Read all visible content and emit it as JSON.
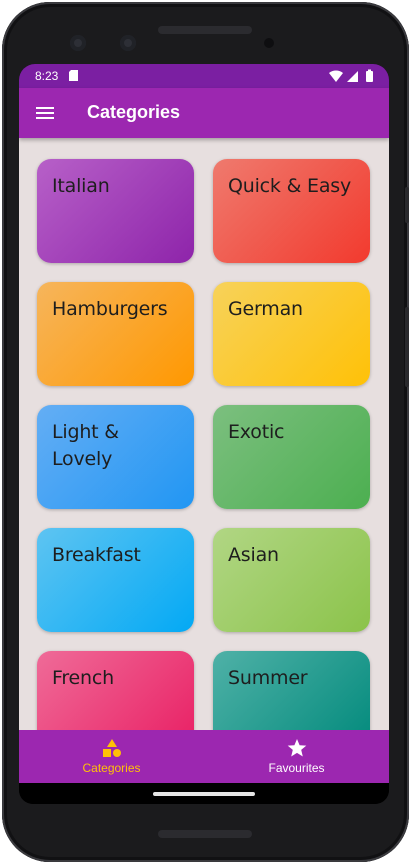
{
  "status_bar": {
    "time": "8:23",
    "background": "#7b1fa2"
  },
  "app_bar": {
    "title": "Categories",
    "menu_icon": "hamburger-menu-icon",
    "background": "#9c27b0"
  },
  "categories": [
    {
      "label": "Italian",
      "color_from": "#b760c8",
      "color_to": "#8e24aa"
    },
    {
      "label": "Quick & Easy",
      "color_from": "#ef7a6e",
      "color_to": "#f23a2e"
    },
    {
      "label": "Hamburgers",
      "color_from": "#f6b55c",
      "color_to": "#ff9800"
    },
    {
      "label": "German",
      "color_from": "#f7d25a",
      "color_to": "#ffc107"
    },
    {
      "label": "Light & Lovely",
      "color_from": "#64aef4",
      "color_to": "#2196f3"
    },
    {
      "label": "Exotic",
      "color_from": "#7cbf7f",
      "color_to": "#4caf50"
    },
    {
      "label": "Breakfast",
      "color_from": "#5ec4f2",
      "color_to": "#03a9f4"
    },
    {
      "label": "Asian",
      "color_from": "#b1d684",
      "color_to": "#8bc34a"
    },
    {
      "label": "French",
      "color_from": "#ef6b98",
      "color_to": "#e91e63"
    },
    {
      "label": "Summer",
      "color_from": "#4fb1a7",
      "color_to": "#00897b"
    }
  ],
  "bottom_nav": {
    "items": [
      {
        "label": "Categories",
        "icon": "category-shapes-icon",
        "active": true
      },
      {
        "label": "Favourites",
        "icon": "star-icon",
        "active": false
      }
    ],
    "active_color": "#ffc107",
    "inactive_color": "#ffffff",
    "background": "#9c27b0"
  }
}
